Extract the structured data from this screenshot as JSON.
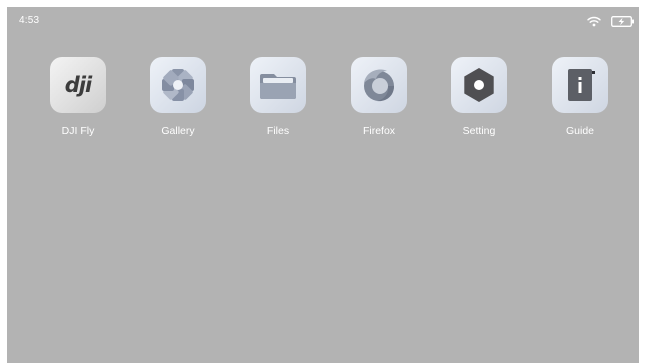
{
  "status_bar": {
    "time": "4:53",
    "wifi_icon": "wifi-icon",
    "battery_icon": "battery-charging-icon"
  },
  "apps": [
    {
      "label": "DJI Fly",
      "icon": "dji-fly-icon"
    },
    {
      "label": "Gallery",
      "icon": "gallery-icon"
    },
    {
      "label": "Files",
      "icon": "folder-icon"
    },
    {
      "label": "Firefox",
      "icon": "firefox-icon"
    },
    {
      "label": "Setting",
      "icon": "settings-icon"
    },
    {
      "label": "Guide",
      "icon": "guide-icon"
    }
  ],
  "colors": {
    "background": "#b3b3b3",
    "text": "#ffffff"
  }
}
